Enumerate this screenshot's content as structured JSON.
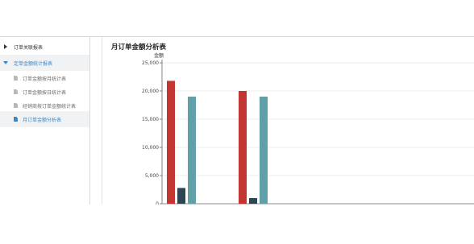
{
  "sidebar": {
    "groups": [
      {
        "label": "订单关联报表",
        "expanded": false
      },
      {
        "label": "定单金额统计报表",
        "expanded": true
      }
    ],
    "items": [
      {
        "label": "订单金额按月统计表"
      },
      {
        "label": "订单金额按日统计表"
      },
      {
        "label": "经销商按订单金额统计表"
      },
      {
        "label": "月订单金额分析表",
        "selected": true
      }
    ]
  },
  "page": {
    "title": "月订单金额分析表"
  },
  "chart_data": {
    "type": "bar",
    "ylabel": "金额",
    "ylim": [
      0,
      25000
    ],
    "yticks": [
      "0",
      "5,000",
      "10,000",
      "15,000",
      "20,000",
      "25,000"
    ],
    "grid": true,
    "series_colors": [
      "#c23531",
      "#2f4554",
      "#61a0a8"
    ],
    "groups": [
      {
        "values": [
          21800,
          2800,
          19000
        ]
      },
      {
        "values": [
          20000,
          1000,
          19000
        ]
      }
    ]
  },
  "colors": {
    "accent": "#3a87c8"
  }
}
